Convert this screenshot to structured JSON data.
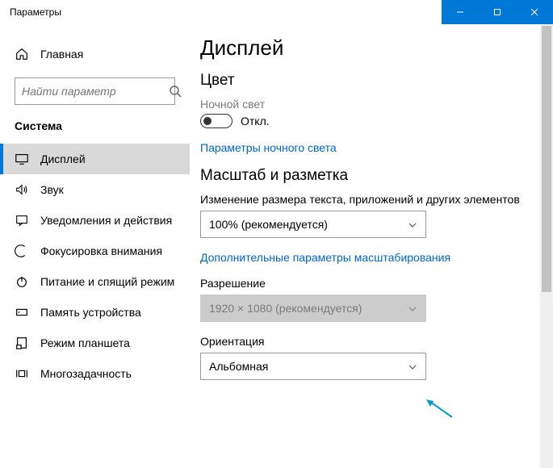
{
  "window": {
    "title": "Параметры"
  },
  "sidebar": {
    "home": "Главная",
    "search_placeholder": "Найти параметр",
    "category": "Система",
    "items": [
      {
        "label": "Дисплей"
      },
      {
        "label": "Звук"
      },
      {
        "label": "Уведомления и действия"
      },
      {
        "label": "Фокусировка внимания"
      },
      {
        "label": "Питание и спящий режим"
      },
      {
        "label": "Память устройства"
      },
      {
        "label": "Режим планшета"
      },
      {
        "label": "Многозадачность"
      }
    ]
  },
  "main": {
    "title": "Дисплей",
    "color_heading": "Цвет",
    "night_light_label": "Ночной свет",
    "night_light_state": "Откл.",
    "night_light_link": "Параметры ночного света",
    "scale_heading": "Масштаб и разметка",
    "scale_label": "Изменение размера текста, приложений и других элементов",
    "scale_value": "100% (рекомендуется)",
    "scale_link": "Дополнительные параметры масштабирования",
    "resolution_label": "Разрешение",
    "resolution_value": "1920 × 1080 (рекомендуется)",
    "orientation_label": "Ориентация",
    "orientation_value": "Альбомная"
  }
}
